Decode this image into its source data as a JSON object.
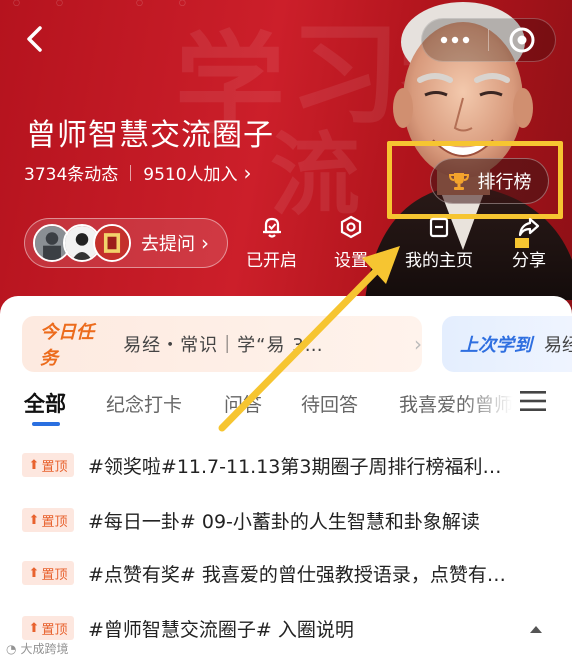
{
  "header": {
    "group_title": "曾师智慧交流圈子",
    "posts_count": "3734条动态",
    "members_count": "9510人加入",
    "members_chevron": "›",
    "ranking_label": "排行榜",
    "ask_label": "去提问",
    "ask_chevron": "›",
    "actions": [
      {
        "label": "已开启",
        "icon": "bell-icon"
      },
      {
        "label": "设置",
        "icon": "settings-hexagon-icon"
      },
      {
        "label": "我的主页",
        "icon": "home-page-icon"
      },
      {
        "label": "分享",
        "icon": "share-icon"
      }
    ],
    "background_calligraphy": [
      "学",
      "习",
      "智",
      "流"
    ],
    "accent_color": "#c8202b"
  },
  "task_card": {
    "tag": "今日任务",
    "text": "易经・常识｜学“易   3…",
    "chevron": "›"
  },
  "last_card": {
    "tag": "上次学到",
    "text": "易经"
  },
  "tabs": [
    {
      "label": "全部",
      "active": true
    },
    {
      "label": "纪念打卡",
      "active": false
    },
    {
      "label": "问答",
      "active": false
    },
    {
      "label": "待回答",
      "active": false
    },
    {
      "label": "我喜爱的曾师",
      "active": false
    }
  ],
  "pin_label": "置顶",
  "posts": [
    {
      "title": "#领奖啦#11.7-11.13第3期圈子周排行榜福利…"
    },
    {
      "title": "#每日一卦# 09-小蓄卦的人生智慧和卦象解读"
    },
    {
      "title": "#点赞有奖# 我喜爱的曾仕强教授语录，点赞有…"
    },
    {
      "title": "#曾师智慧交流圈子# 入圈说明"
    }
  ],
  "watermark": "大成跨境",
  "highlight_color": "#f6c531"
}
